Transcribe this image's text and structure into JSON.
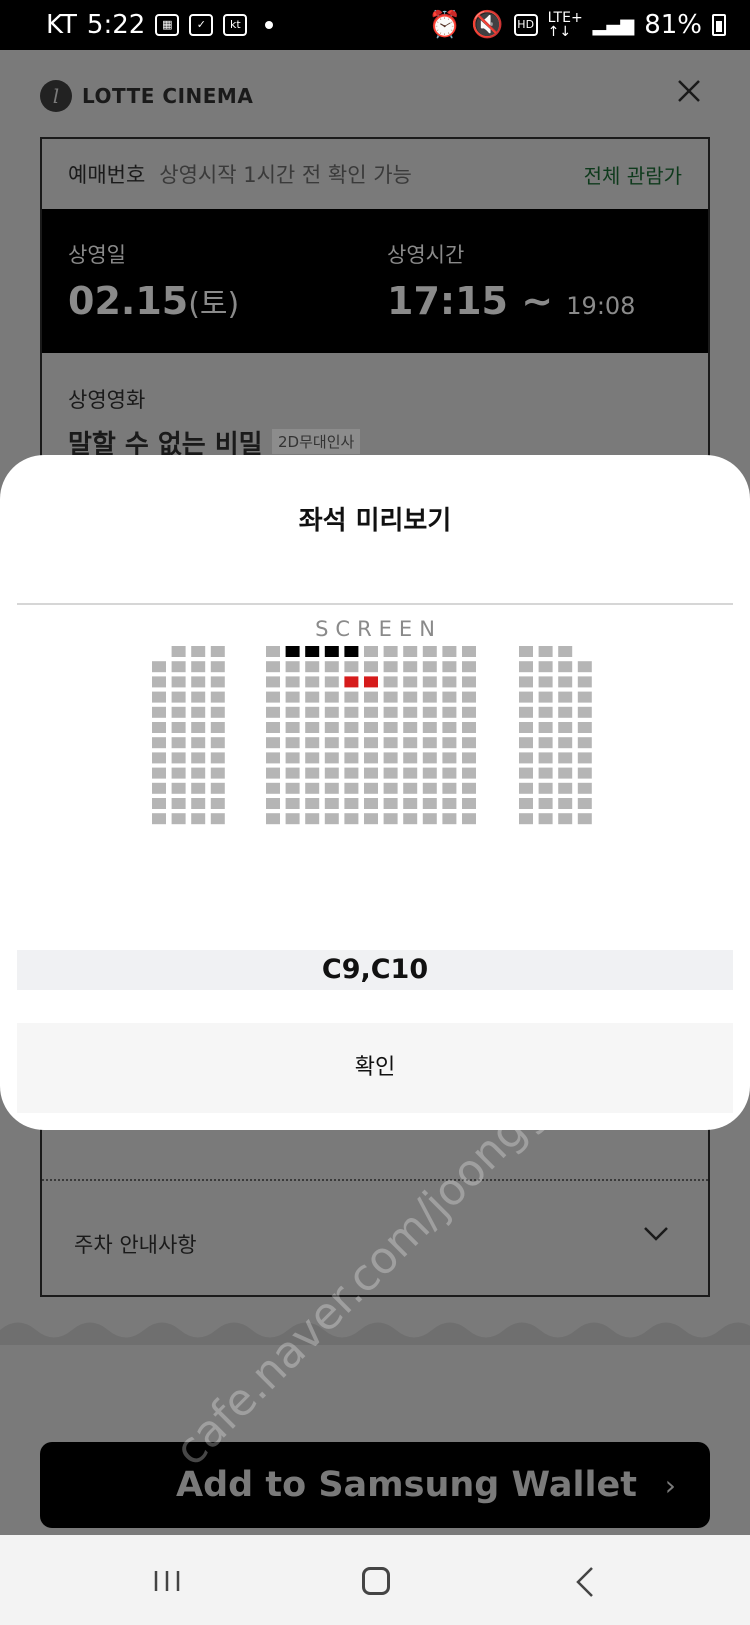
{
  "status_bar": {
    "carrier": "KT",
    "time": "5:22",
    "left_icons": [
      "gallery-icon",
      "notification-icon",
      "kt-icon"
    ],
    "right_icons": [
      "alarm-icon",
      "mute-icon",
      "hd-icon",
      "lte-icon",
      "signal-icon"
    ],
    "battery": "81%"
  },
  "header": {
    "brand": "LOTTE CINEMA",
    "close_icon": "close-icon"
  },
  "ticket": {
    "reservation_label": "예매번호",
    "reservation_note": "상영시작 1시간 전 확인 가능",
    "rating": "전체 관람가",
    "date_label": "상영일",
    "date_value": "02.15",
    "date_day": "(토)",
    "time_label": "상영시간",
    "time_start": "17:15",
    "time_sep": "~",
    "time_end": "19:08",
    "movie_label": "상영영화",
    "movie_title": "말할 수 없는 비밀",
    "movie_tag": "2D무대인사",
    "parking_label": "주차 안내사항"
  },
  "wallet": {
    "label": "Add to  Samsung Wallet",
    "chevron": "›"
  },
  "modal": {
    "title": "좌석 미리보기",
    "screen_label": "SCREEN",
    "selected_seats": "C9,C10",
    "confirm_label": "확인"
  },
  "colors": {
    "available_seat": "#b5b5b5",
    "booked_seat": "#000000",
    "selected_seat": "#d61c1c"
  },
  "seat_map": {
    "blocks": [
      {
        "name": "left",
        "rows": 12,
        "cols": 4
      },
      {
        "name": "center",
        "rows": 12,
        "cols": 11
      },
      {
        "name": "right",
        "rows": 12,
        "cols": 4
      }
    ],
    "booked": [
      [
        "center",
        0,
        1
      ],
      [
        "center",
        0,
        2
      ],
      [
        "center",
        0,
        3
      ],
      [
        "center",
        0,
        4
      ]
    ],
    "selected": [
      [
        "center",
        2,
        4
      ],
      [
        "center",
        2,
        5
      ]
    ],
    "missing": [
      [
        "left",
        0,
        0
      ],
      [
        "right",
        0,
        3
      ]
    ]
  },
  "watermark": "cafe.naver.com/joonggonara"
}
